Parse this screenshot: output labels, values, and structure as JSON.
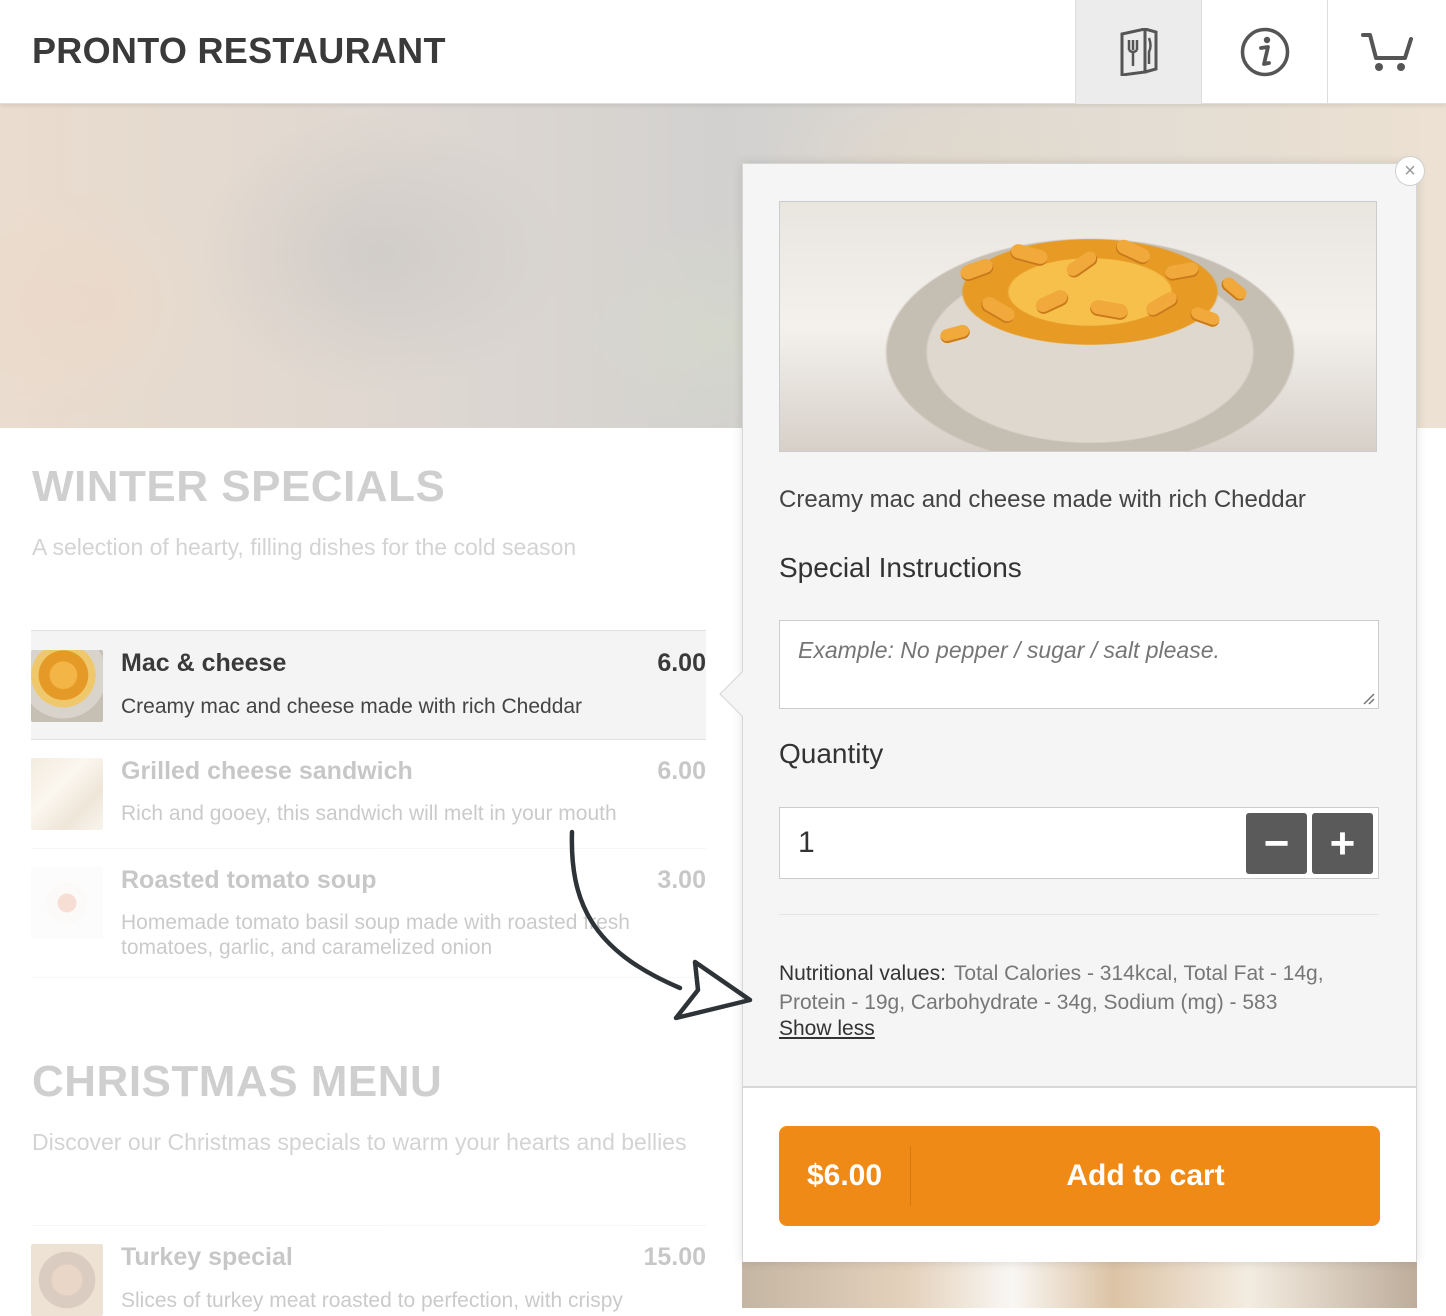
{
  "header": {
    "brand": "PRONTO RESTAURANT",
    "icons": [
      "menu-icon",
      "info-icon",
      "cart-icon"
    ]
  },
  "sections": [
    {
      "title": "WINTER SPECIALS",
      "subtitle": "A selection of hearty, filling dishes for the cold season",
      "items": [
        {
          "name": "Mac & cheese",
          "price": "6.00",
          "desc": "Creamy mac and cheese made with rich Cheddar"
        },
        {
          "name": "Grilled cheese sandwich",
          "price": "6.00",
          "desc": "Rich and gooey, this sandwich will melt in your mouth"
        },
        {
          "name": "Roasted tomato soup",
          "price": "3.00",
          "desc": "Homemade tomato basil soup made with roasted fresh tomatoes, garlic, and caramelized onion"
        }
      ]
    },
    {
      "title": "CHRISTMAS MENU",
      "subtitle": "Discover our Christmas specials to warm your hearts and bellies",
      "items": [
        {
          "name": "Turkey special",
          "price": "15.00",
          "desc": "Slices of turkey meat roasted to perfection, with crispy"
        }
      ]
    }
  ],
  "popup": {
    "description": "Creamy mac and cheese made with rich Cheddar",
    "instructions_label": "Special Instructions",
    "instructions_placeholder": "Example: No pepper / sugar / salt please.",
    "quantity_label": "Quantity",
    "quantity_value": "1",
    "minus_label": "−",
    "plus_label": "+",
    "nutrition_key": "Nutritional values:",
    "nutrition_value": "Total Calories - 314kcal, Total Fat - 14g, Protein - 19g, Carbohydrate - 34g, Sodium (mg) - 583",
    "show_less": "Show less",
    "close_label": "×",
    "cart_price": "$6.00",
    "cart_label": "Add to cart"
  },
  "colors": {
    "accent": "#ef8a17",
    "stepper": "#5a5a5a"
  }
}
